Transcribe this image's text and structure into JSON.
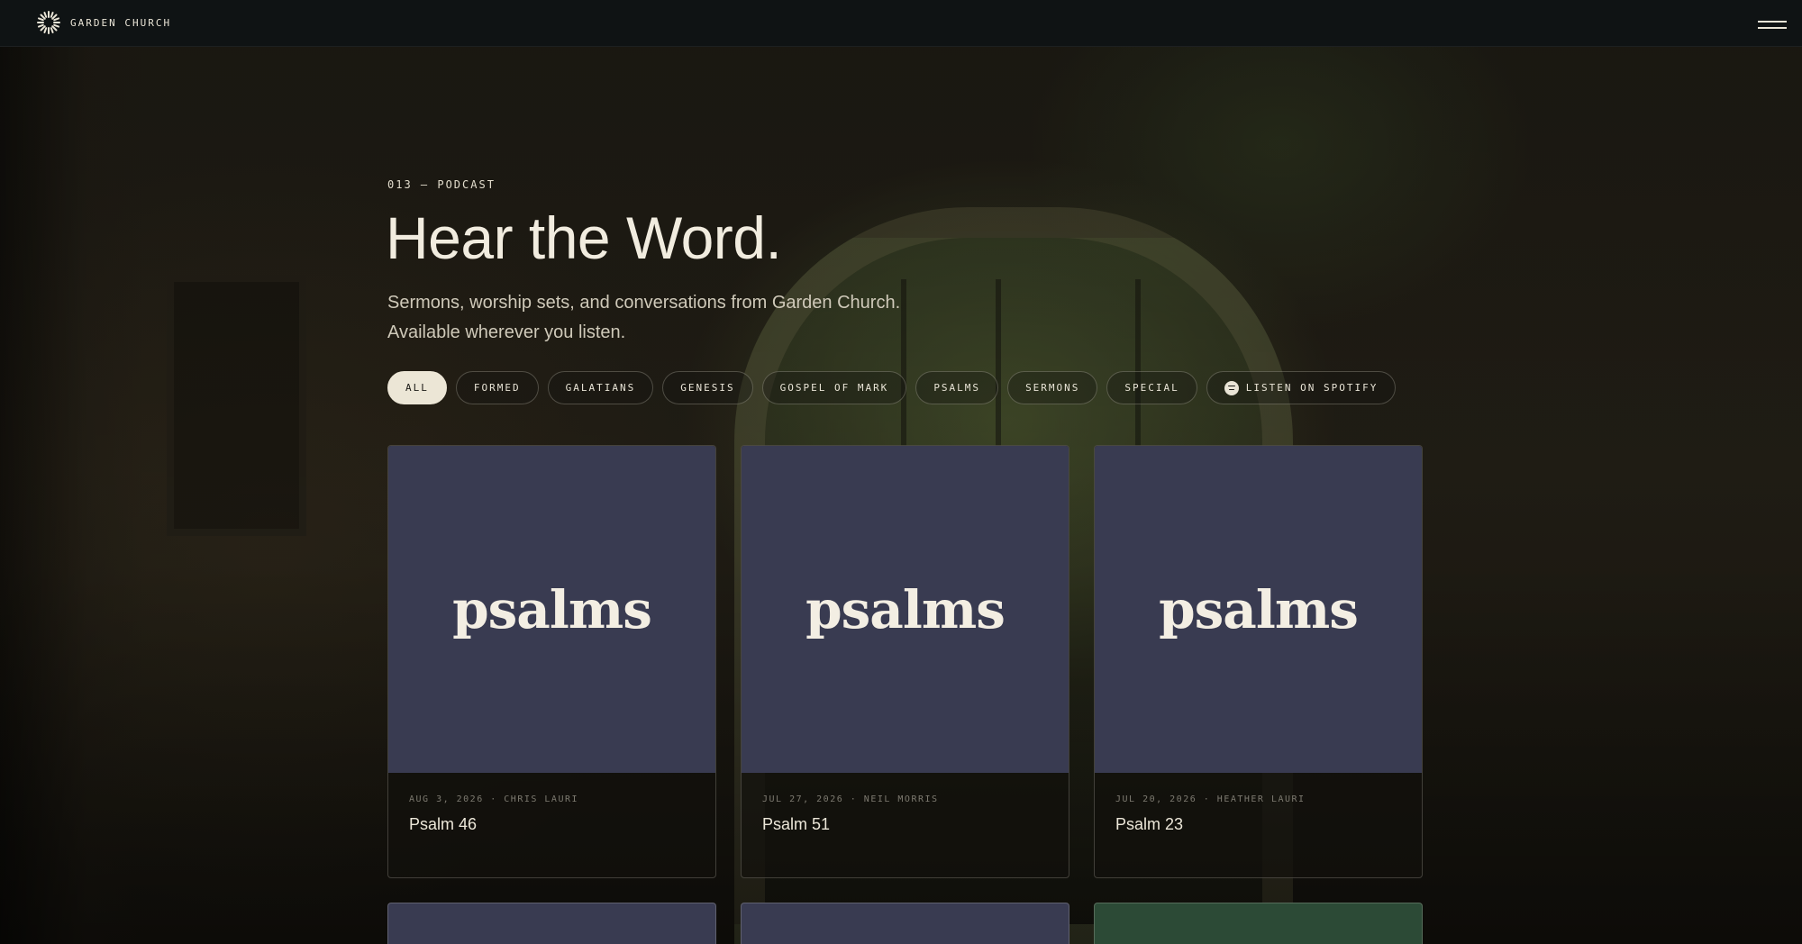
{
  "header": {
    "brand_name": "GARDEN CHURCH",
    "logo_icon": "sunburst-icon",
    "menu_icon": "hamburger-menu-icon"
  },
  "hero": {
    "eyebrow": "013 — PODCAST",
    "title": "Hear the Word.",
    "subtitle_line1": "Sermons, worship sets, and conversations from Garden Church.",
    "subtitle_line2": "Available wherever you listen."
  },
  "filters": [
    {
      "label": "ALL",
      "active": true
    },
    {
      "label": "FORMED",
      "active": false
    },
    {
      "label": "GALATIANS",
      "active": false
    },
    {
      "label": "GENESIS",
      "active": false
    },
    {
      "label": "GOSPEL OF MARK",
      "active": false
    },
    {
      "label": "PSALMS",
      "active": false
    },
    {
      "label": "SERMONS",
      "active": false
    },
    {
      "label": "SPECIAL",
      "active": false
    }
  ],
  "spotify": {
    "label": "LISTEN ON SPOTIFY",
    "icon": "spotify-icon"
  },
  "episodes": [
    {
      "art_text": "psalms",
      "meta": "AUG 3, 2026 · CHRIS LAURI",
      "title": "Psalm 46",
      "art_color": "#393b51"
    },
    {
      "art_text": "psalms",
      "meta": "JUL 27, 2026 · NEIL MORRIS",
      "title": "Psalm 51",
      "art_color": "#393b51"
    },
    {
      "art_text": "psalms",
      "meta": "JUL 20, 2026 · HEATHER LAURI",
      "title": "Psalm 23",
      "art_color": "#393b51"
    }
  ],
  "next_row_art_colors": [
    "#393b51",
    "#393b51",
    "#2c4a36"
  ],
  "colors": {
    "topbar": "#0f1314",
    "active_chip": "#ece6d6",
    "card_art": "#393b51"
  }
}
